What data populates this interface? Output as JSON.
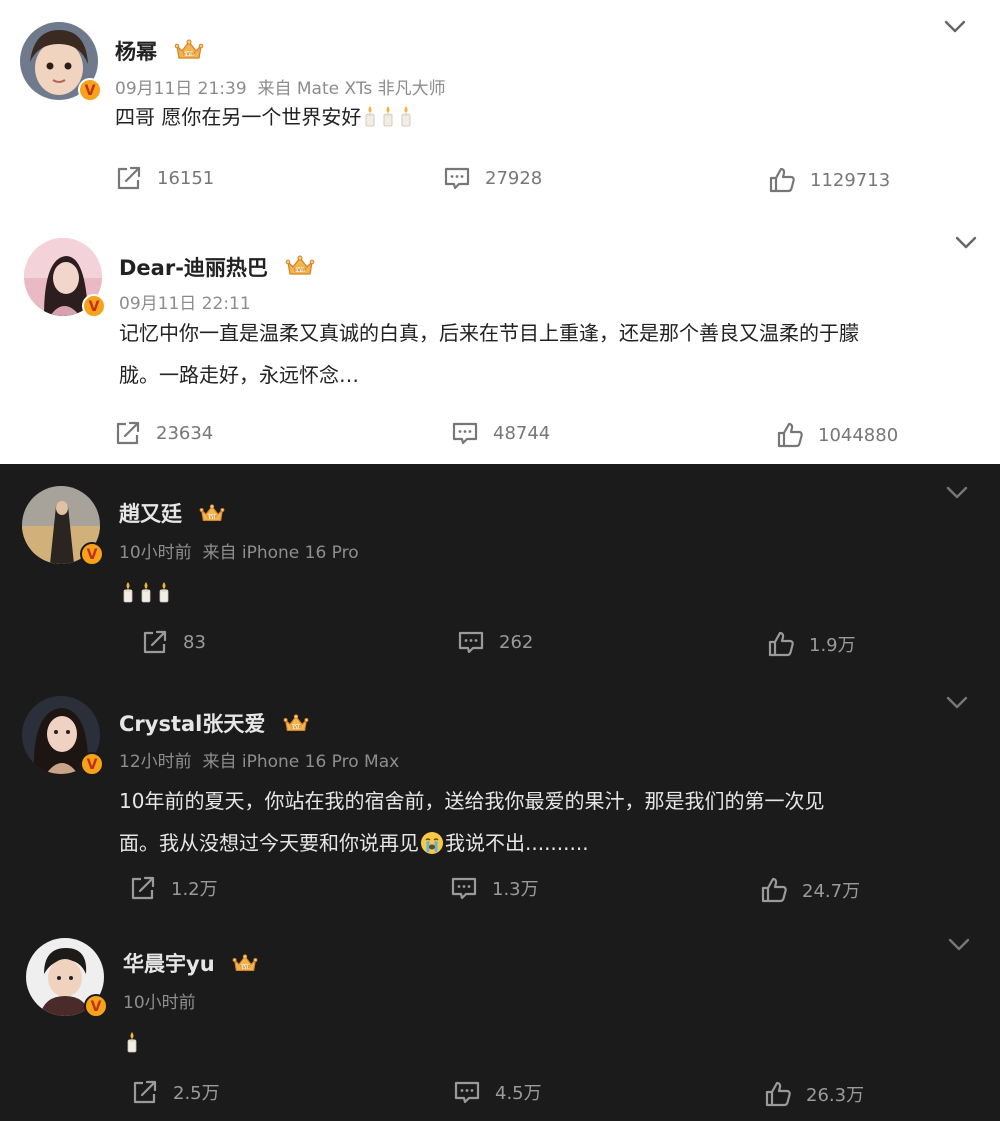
{
  "posts": [
    {
      "user": "杨幂",
      "time": "09月11日 21:39",
      "source": "来自 Mate XTs 非凡大师",
      "text": "四哥 愿你在另一个世界安好",
      "emoji": [
        "candle",
        "candle",
        "candle"
      ],
      "repost": "16151",
      "comment": "27928",
      "like": "1129713"
    },
    {
      "user": "Dear-迪丽热巴",
      "time": "09月11日 22:11",
      "source": "",
      "text_line1": "记忆中你一直是温柔又真诚的白真，后来在节目上重逢，还是那个善良又温柔的于朦",
      "text_line2": "胧。一路走好，永远怀念…",
      "repost": "23634",
      "comment": "48744",
      "like": "1044880"
    },
    {
      "user": "趙又廷",
      "time": "10小时前",
      "source": "来自 iPhone 16 Pro",
      "text": "",
      "emoji": [
        "candle",
        "candle",
        "candle"
      ],
      "repost": "83",
      "comment": "262",
      "like": "1.9万"
    },
    {
      "user": "Crystal张天爱",
      "time": "12小时前",
      "source": "来自 iPhone 16 Pro Max",
      "text_line1": "10年前的夏天，你站在我的宿舍前，送给我你最爱的果汁，那是我们的第一次见",
      "text_line2a": "面。我从没想过今天要和你说再见",
      "text_line2b": "我说不出..........",
      "emoji": [
        "crying-face"
      ],
      "repost": "1.2万",
      "comment": "1.3万",
      "like": "24.7万"
    },
    {
      "user": "华晨宇yu",
      "time": "10小时前",
      "source": "",
      "text": "",
      "emoji": [
        "candle"
      ],
      "repost": "2.5万",
      "comment": "4.5万",
      "like": "26.3万"
    }
  ],
  "icons": {
    "verified": "V",
    "more": "chevron-down-icon",
    "repost": "repost-icon",
    "comment": "comment-icon",
    "like": "thumbs-up-icon",
    "crown": "crown-icon",
    "candle": "candle-icon",
    "crying": "crying-face-icon"
  },
  "colors": {
    "light_bg": "#ffffff",
    "dark_bg": "#1b1b1b",
    "verified_badge": "#f7a21b",
    "crown": "#f2a93b"
  }
}
